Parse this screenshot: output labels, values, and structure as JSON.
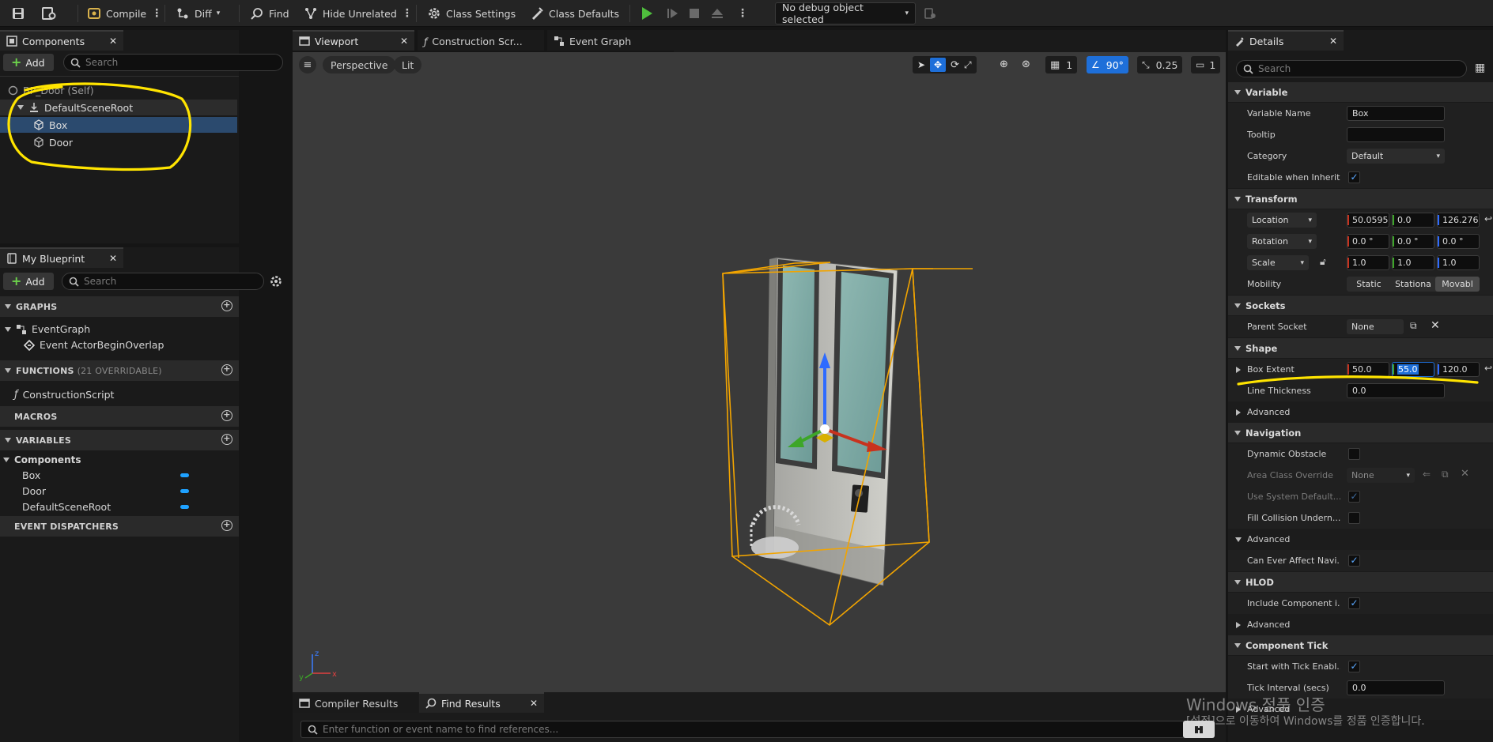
{
  "toolbar": {
    "compile": "Compile",
    "diff": "Diff",
    "find": "Find",
    "hide_unrelated": "Hide Unrelated",
    "class_settings": "Class Settings",
    "class_defaults": "Class Defaults",
    "debug_object": "No debug object selected"
  },
  "components": {
    "tab": "Components",
    "add": "Add",
    "search_placeholder": "Search",
    "self_label": "BP_Door (Self)",
    "items": [
      "DefaultSceneRoot",
      "Box",
      "Door"
    ]
  },
  "my_blueprint": {
    "tab": "My Blueprint",
    "add": "Add",
    "search_placeholder": "Search",
    "graphs_header": "GRAPHS",
    "event_graph": "EventGraph",
    "event_actor": "Event ActorBeginOverlap",
    "functions_header": "FUNCTIONS",
    "functions_sub": "(21 OVERRIDABLE)",
    "construction_script": "ConstructionScript",
    "macros_header": "MACROS",
    "variables_header": "VARIABLES",
    "components_group": "Components",
    "variables": [
      "Box",
      "Door",
      "DefaultSceneRoot"
    ],
    "event_dispatchers_header": "EVENT DISPATCHERS"
  },
  "editor_tabs": [
    "Viewport",
    "Construction Scr...",
    "Event Graph"
  ],
  "viewport": {
    "perspective": "Perspective",
    "lit": "Lit",
    "grid_value": "1",
    "angle_value": "90°",
    "scale_value": "0.25",
    "camera_value": "1"
  },
  "bottom": {
    "compiler_results": "Compiler Results",
    "find_results": "Find Results",
    "find_placeholder": "Enter function or event name to find references..."
  },
  "details": {
    "tab": "Details",
    "search_placeholder": "Search",
    "variable_header": "Variable",
    "variable_name_label": "Variable Name",
    "variable_name_value": "Box",
    "tooltip_label": "Tooltip",
    "category_label": "Category",
    "category_value": "Default",
    "editable_label": "Editable when Inherit...",
    "transform_header": "Transform",
    "location_label": "Location",
    "location_values": [
      "50.0595",
      "0.0",
      "126.276"
    ],
    "rotation_label": "Rotation",
    "rotation_values": [
      "0.0 °",
      "0.0 °",
      "0.0 °"
    ],
    "scale_label": "Scale",
    "scale_values": [
      "1.0",
      "1.0",
      "1.0"
    ],
    "mobility_label": "Mobility",
    "mobility_options": [
      "Static",
      "Stationa",
      "Movabl"
    ],
    "sockets_header": "Sockets",
    "parent_socket_label": "Parent Socket",
    "parent_socket_value": "None",
    "shape_header": "Shape",
    "box_extent_label": "Box Extent",
    "box_extent_values": [
      "50.0",
      "55.0",
      "120.0"
    ],
    "line_thickness_label": "Line Thickness",
    "line_thickness_value": "0.0",
    "advanced": "Advanced",
    "navigation_header": "Navigation",
    "dynamic_obstacle_label": "Dynamic Obstacle",
    "area_class_label": "Area Class Override",
    "area_class_value": "None",
    "use_system_label": "Use System Default...",
    "fill_collision_label": "Fill Collision Undern...",
    "can_affect_label": "Can Ever Affect Navi...",
    "hlod_header": "HLOD",
    "include_component_label": "Include Component i...",
    "component_tick_header": "Component Tick",
    "start_tick_label": "Start with Tick Enabl...",
    "tick_interval_label": "Tick Interval (secs)",
    "tick_interval_value": "0.0"
  },
  "watermark": {
    "line1": "Windows 정품 인증",
    "line2": "[설정]으로 이동하여 Windows를 정품 인증합니다."
  },
  "colors": {
    "selection": "#2b4a6e",
    "accent_blue": "#1ea1ff",
    "annotation_yellow": "#ffe400",
    "play_green": "#4fbf3d"
  }
}
